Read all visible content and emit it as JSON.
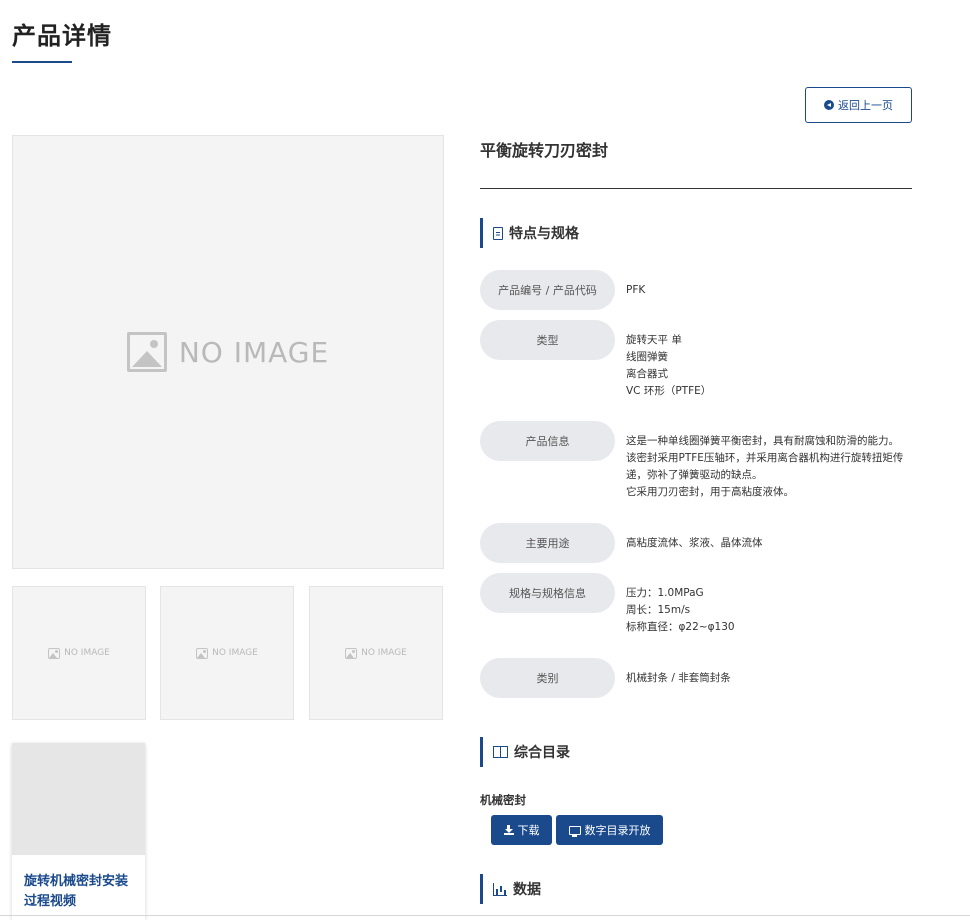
{
  "page": {
    "title": "产品详情"
  },
  "back_button": {
    "label": "返回上一页"
  },
  "gallery": {
    "main_placeholder": "NO IMAGE",
    "thumbnails": [
      {
        "label": "NO IMAGE"
      },
      {
        "label": "NO IMAGE"
      },
      {
        "label": "NO IMAGE"
      }
    ]
  },
  "video": {
    "title": "旋转机械密封安装过程视频"
  },
  "product": {
    "name": "平衡旋转刀刃密封"
  },
  "features": {
    "heading": "特点与规格",
    "rows": [
      {
        "label": "产品编号 / 产品代码",
        "value": "PFK"
      },
      {
        "label": "类型",
        "value": "旋转天平 单\n线圈弹簧\n离合器式\nVC 环形（PTFE）"
      },
      {
        "label": "产品信息",
        "value": "这是一种单线圈弹簧平衡密封，具有耐腐蚀和防滑的能力。该密封采用PTFE压轴环，并采用离合器机构进行旋转扭矩传递，弥补了弹簧驱动的缺点。\n它采用刀刃密封，用于高粘度液体。"
      },
      {
        "label": "主要用途",
        "value": "高粘度流体、浆液、晶体流体"
      },
      {
        "label": "规格与规格信息",
        "value": "压力：1.0MPaG\n周长：15m/s\n标称直径：φ22~φ130"
      },
      {
        "label": "类别",
        "value": "机械封条 / 非套筒封条"
      }
    ]
  },
  "catalog": {
    "heading": "综合目录",
    "item_label": "机械密封",
    "download_label": "下载",
    "digital_label": "数字目录开放"
  },
  "data_section": {
    "heading": "数据"
  },
  "colors": {
    "accent": "#1a4a8c",
    "pill": "#e8e9ec",
    "placeholder_bg": "#f4f4f4"
  }
}
